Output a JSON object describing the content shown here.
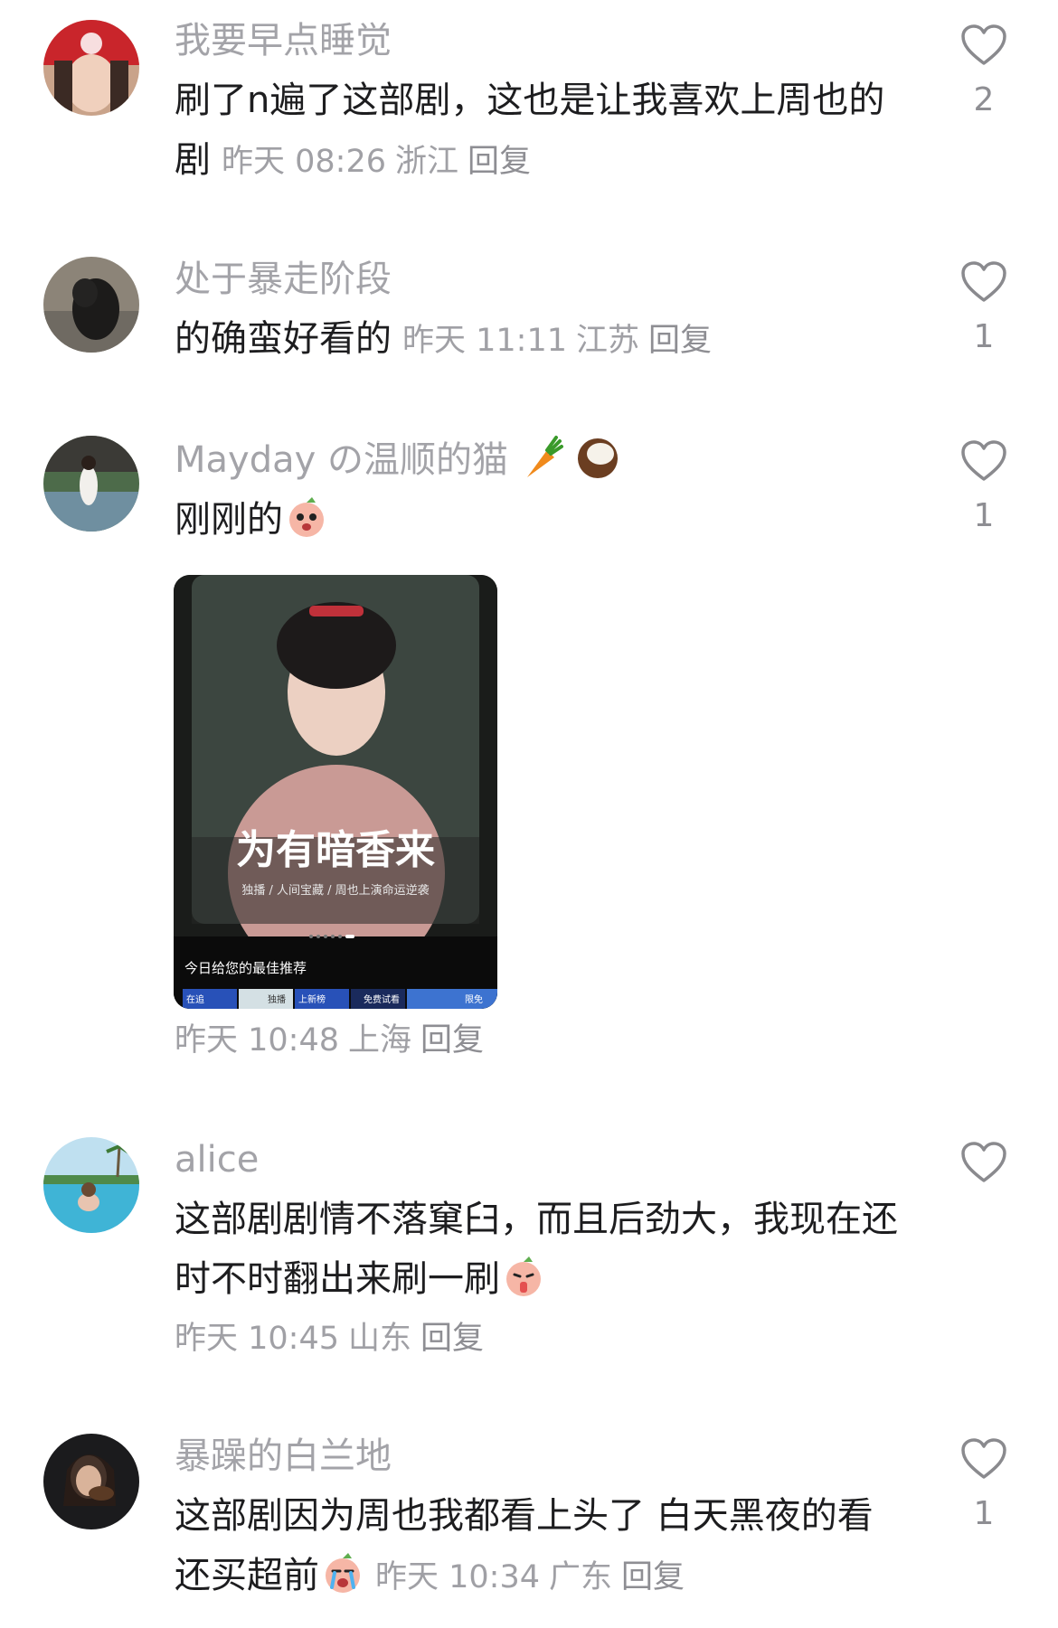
{
  "comments": [
    {
      "user": "我要早点睡觉",
      "text": "刷了n遍了这部剧，这也是让我喜欢上周也的剧",
      "time": "昨天 08:26",
      "location": "浙江",
      "reply": "回复",
      "likes": "2"
    },
    {
      "user": "处于暴走阶段",
      "text": "的确蛮好看的",
      "time": "昨天 11:11",
      "location": "江苏",
      "reply": "回复",
      "likes": "1"
    },
    {
      "user": "Mayday の温顺的猫",
      "text": "刚刚的",
      "time": "昨天 10:48",
      "location": "上海",
      "reply": "回复",
      "likes": "1",
      "image": {
        "title": "为有暗香来",
        "subtitle": "独播 / 人间宝藏 / 周也上演命运逆袭",
        "banner": "今日给您的最佳推荐",
        "tags": [
          "在追",
          "独播",
          "上新榜",
          "免费试看",
          "限免"
        ]
      }
    },
    {
      "user": "alice",
      "text": "这部剧剧情不落窠臼，而且后劲大，我现在还时不时翻出来刷一刷",
      "time": "昨天 10:45",
      "location": "山东",
      "reply": "回复",
      "likes": ""
    },
    {
      "user": "暴躁的白兰地",
      "text": "这部剧因为周也我都看上头了 白天黑夜的看还买超前",
      "time": "昨天 10:34",
      "location": "广东",
      "reply": "回复",
      "likes": "1"
    }
  ],
  "colors": {
    "username": "#a3a3a8",
    "text": "#1d1d1f",
    "meta": "#a0a0a5",
    "heart": "#8a8a8e"
  }
}
